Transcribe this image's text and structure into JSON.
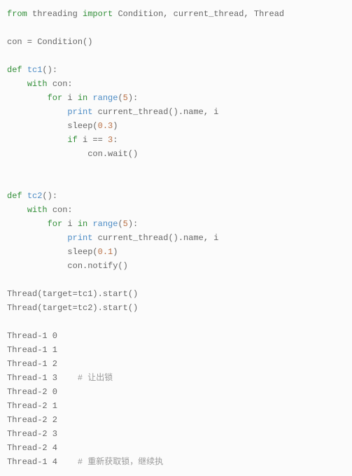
{
  "code": {
    "l1_from": "from",
    "l1_mod": "threading",
    "l1_import": "import",
    "l1_names": "Condition, current_thread, Thread",
    "l3_assign": "con = Condition()",
    "l5_def": "def",
    "l5_name": "tc1",
    "l5_sig": "():",
    "l6_with": "with",
    "l6_expr": "con:",
    "l7_for": "for",
    "l7_var": "i",
    "l7_in": "in",
    "l7_range": "range",
    "l7_open": "(",
    "l7_n": "5",
    "l7_close": "):",
    "l8_print": "print",
    "l8_rest": "current_thread().name, i",
    "l9_sleep": "sleep(",
    "l9_n": "0.3",
    "l9_close": ")",
    "l10_if": "if",
    "l10_cond_a": "i ==",
    "l10_cond_n": "3",
    "l10_colon": ":",
    "l11": "con.wait()",
    "l14_def": "def",
    "l14_name": "tc2",
    "l14_sig": "():",
    "l15_with": "with",
    "l15_expr": "con:",
    "l16_for": "for",
    "l16_var": "i",
    "l16_in": "in",
    "l16_range": "range",
    "l16_open": "(",
    "l16_n": "5",
    "l16_close": "):",
    "l17_print": "print",
    "l17_rest": "current_thread().name, i",
    "l18_sleep": "sleep(",
    "l18_n": "0.1",
    "l18_close": ")",
    "l19": "con.notify()",
    "l21": "Thread(target=tc1).start()",
    "l22": "Thread(target=tc2).start()"
  },
  "output": {
    "r1": "Thread-1 0",
    "r2": "Thread-1 1",
    "r3": "Thread-1 2",
    "r4": "Thread-1 3",
    "c4": "# 让出锁",
    "r5": "Thread-2 0",
    "r6": "Thread-2 1",
    "r7": "Thread-2 2",
    "r8": "Thread-2 3",
    "r9": "Thread-2 4",
    "r10": "Thread-1 4",
    "c10": "# 重新获取锁，继续执"
  }
}
